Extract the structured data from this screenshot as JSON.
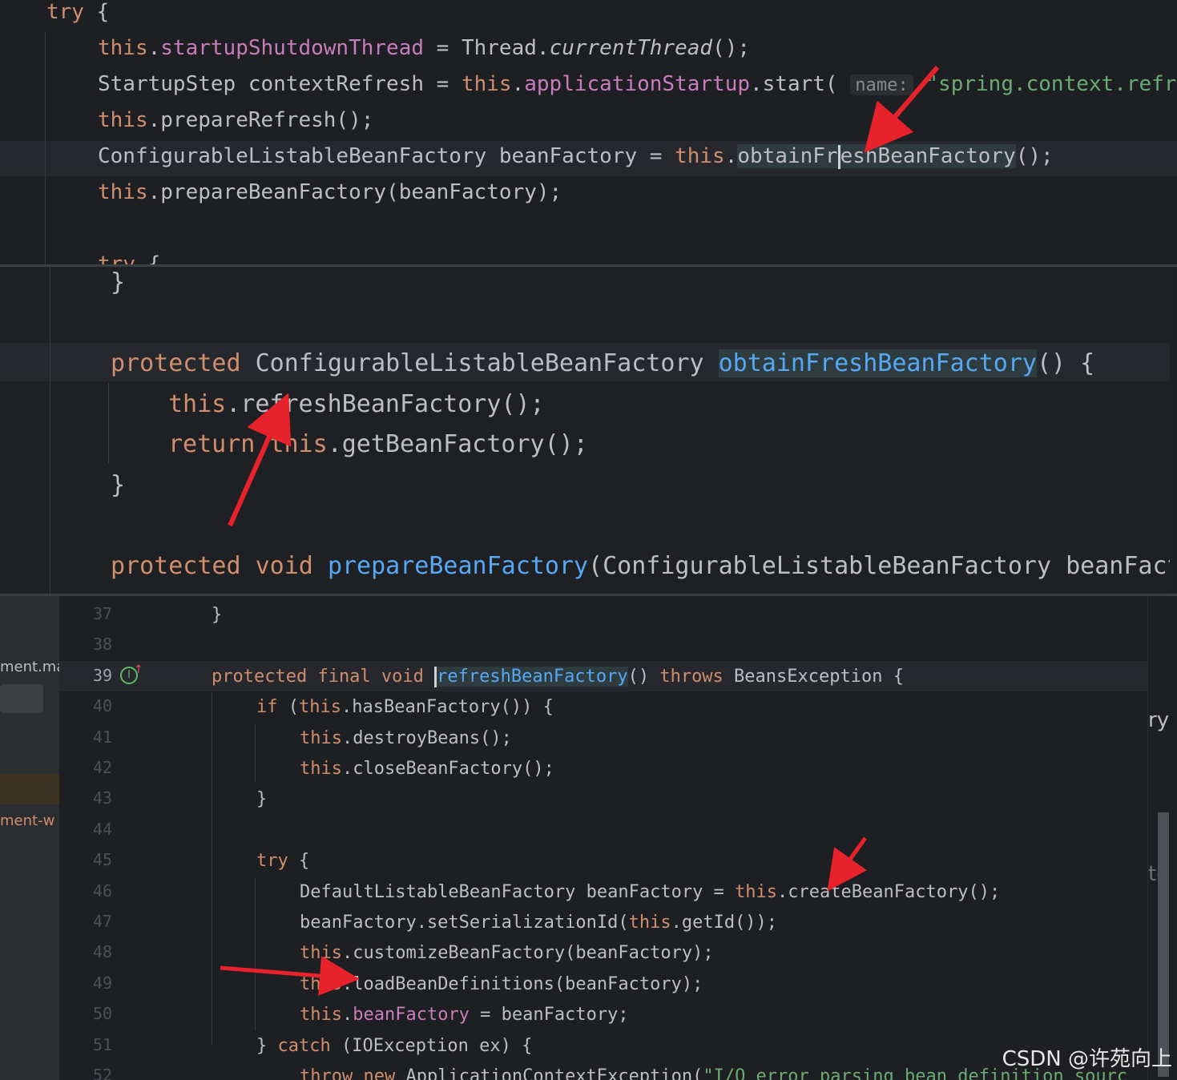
{
  "panel1": {
    "lines": [
      {
        "parts": [
          [
            "kw",
            "try"
          ],
          [
            "txt",
            " {"
          ]
        ]
      },
      {
        "parts": [
          [
            "kw",
            "this"
          ],
          [
            "txt",
            "."
          ],
          [
            "fld",
            "startupShutdownThread"
          ],
          [
            "txt",
            " = Thread."
          ],
          [
            "txt it",
            "currentThread"
          ],
          [
            "txt",
            "();"
          ]
        ]
      },
      {
        "parts": [
          [
            "txt",
            "StartupStep contextRefresh = "
          ],
          [
            "kw",
            "this"
          ],
          [
            "txt",
            "."
          ],
          [
            "fld",
            "applicationStartup"
          ],
          [
            "txt",
            ".start( "
          ],
          [
            "hint",
            "name:"
          ],
          [
            "str",
            " \"spring.context.refr"
          ]
        ]
      },
      {
        "parts": [
          [
            "kw",
            "this"
          ],
          [
            "txt",
            ".prepareRefresh();"
          ]
        ]
      },
      {
        "parts": [
          [
            "txt",
            "ConfigurableListableBeanFactory beanFactory = "
          ],
          [
            "kw",
            "this"
          ],
          [
            "txt",
            "."
          ],
          [
            "txt hl",
            "obtainFr"
          ],
          [
            "caret",
            ""
          ],
          [
            "txt hl",
            "eshBeanFactory"
          ],
          [
            "txt",
            "();"
          ]
        ]
      },
      {
        "parts": [
          [
            "kw",
            "this"
          ],
          [
            "txt",
            ".prepareBeanFactory(beanFactory);"
          ]
        ]
      },
      {
        "parts": [
          [
            "txt",
            ""
          ]
        ]
      },
      {
        "parts": [
          [
            "kw",
            "try"
          ],
          [
            "txt",
            " {"
          ]
        ]
      }
    ]
  },
  "panel2": {
    "lines": [
      {
        "parts": [
          [
            "txt",
            "}"
          ]
        ]
      },
      {
        "parts": [
          [
            "txt",
            ""
          ]
        ]
      },
      {
        "parts": [
          [
            "kw",
            "protected"
          ],
          [
            "txt",
            " ConfigurableListableBeanFactory "
          ],
          [
            "fn hl",
            "obtainFreshBeanFactory"
          ],
          [
            "txt",
            "() {"
          ]
        ]
      },
      {
        "parts": [
          [
            "kw",
            "this"
          ],
          [
            "txt",
            ".refreshBeanFactory();"
          ]
        ]
      },
      {
        "parts": [
          [
            "kw",
            "return"
          ],
          [
            "txt",
            " "
          ],
          [
            "kw",
            "this"
          ],
          [
            "txt",
            ".getBeanFactory();"
          ]
        ]
      },
      {
        "parts": [
          [
            "txt",
            "}"
          ]
        ]
      },
      {
        "parts": [
          [
            "txt",
            ""
          ]
        ]
      },
      {
        "parts": [
          [
            "kw",
            "protected void "
          ],
          [
            "fn",
            "prepareBeanFactory"
          ],
          [
            "txt",
            "(ConfigurableListableBeanFactory beanFact"
          ]
        ]
      }
    ]
  },
  "panel3": {
    "line_numbers": [
      "37",
      "38",
      "39",
      "40",
      "41",
      "42",
      "43",
      "44",
      "45",
      "46",
      "47",
      "48",
      "49",
      "50",
      "51",
      "52"
    ],
    "lines": [
      {
        "parts": [
          [
            "txt",
            "}"
          ]
        ]
      },
      {
        "parts": [
          [
            "txt",
            ""
          ]
        ]
      },
      {
        "parts": [
          [
            "kw",
            "protected final void "
          ],
          [
            "caret",
            ""
          ],
          [
            "fn hl",
            "refreshBeanFactory"
          ],
          [
            "txt",
            "() "
          ],
          [
            "kw",
            "throws"
          ],
          [
            "txt",
            " BeansException {"
          ]
        ]
      },
      {
        "parts": [
          [
            "kw",
            "if"
          ],
          [
            "txt",
            " ("
          ],
          [
            "kw",
            "this"
          ],
          [
            "txt",
            ".hasBeanFactory()) {"
          ]
        ]
      },
      {
        "parts": [
          [
            "kw",
            "this"
          ],
          [
            "txt",
            ".destroyBeans();"
          ]
        ]
      },
      {
        "parts": [
          [
            "kw",
            "this"
          ],
          [
            "txt",
            ".closeBeanFactory();"
          ]
        ]
      },
      {
        "parts": [
          [
            "txt",
            "}"
          ]
        ]
      },
      {
        "parts": [
          [
            "txt",
            ""
          ]
        ]
      },
      {
        "parts": [
          [
            "kw",
            "try"
          ],
          [
            "txt",
            " {"
          ]
        ]
      },
      {
        "parts": [
          [
            "txt",
            "DefaultListableBeanFactory beanFactory = "
          ],
          [
            "kw",
            "this"
          ],
          [
            "txt",
            ".createBeanFactory();"
          ]
        ]
      },
      {
        "parts": [
          [
            "txt",
            "beanFactory.setSerializationId("
          ],
          [
            "kw",
            "this"
          ],
          [
            "txt",
            ".getId());"
          ]
        ]
      },
      {
        "parts": [
          [
            "kw",
            "this"
          ],
          [
            "txt",
            ".customizeBeanFactory(beanFactory);"
          ]
        ]
      },
      {
        "parts": [
          [
            "kw",
            "this"
          ],
          [
            "txt",
            ".loadBeanDefinitions(beanFactory);"
          ]
        ]
      },
      {
        "parts": [
          [
            "kw",
            "this"
          ],
          [
            "txt",
            "."
          ],
          [
            "fld",
            "beanFactory"
          ],
          [
            "txt",
            " = beanFactory;"
          ]
        ]
      },
      {
        "parts": [
          [
            "txt",
            "} "
          ],
          [
            "kw",
            "catch"
          ],
          [
            "txt",
            " (IOException ex) {"
          ]
        ]
      },
      {
        "parts": [
          [
            "kw",
            "throw new"
          ],
          [
            "txt",
            " ApplicationContextException("
          ],
          [
            "str",
            "\"I/O error parsing bean definition sourc"
          ]
        ]
      }
    ],
    "left_labels": [
      "ment.ma",
      "ment-w"
    ],
    "right_labels": [
      "ry",
      "to"
    ]
  },
  "watermark": "CSDN @许苑向上",
  "colors": {
    "background": "#1e1f22",
    "keyword": "#cf8e6d",
    "field": "#c77dbb",
    "method_decl": "#56a8f5",
    "string": "#6aab73",
    "text": "#bcbec4",
    "arrow": "#e8222a"
  }
}
